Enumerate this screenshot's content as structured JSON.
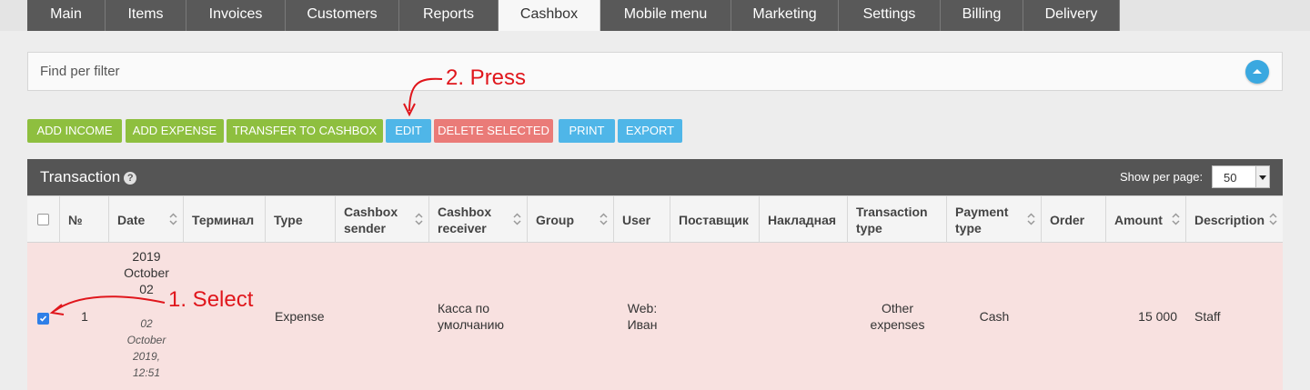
{
  "nav": {
    "tabs": [
      {
        "label": "Main"
      },
      {
        "label": "Items"
      },
      {
        "label": "Invoices"
      },
      {
        "label": "Customers"
      },
      {
        "label": "Reports"
      },
      {
        "label": "Cashbox",
        "active": true
      },
      {
        "label": "Mobile menu"
      },
      {
        "label": "Marketing"
      },
      {
        "label": "Settings"
      },
      {
        "label": "Billing"
      },
      {
        "label": "Delivery"
      }
    ]
  },
  "filter": {
    "label": "Find per filter",
    "toggle_icon": "chevron-up-icon"
  },
  "annotations": {
    "press": "2. Press",
    "select": "1. Select",
    "color": "#e0161c"
  },
  "toolbar": {
    "add_income": "ADD INCOME",
    "add_expense": "ADD EXPENSE",
    "transfer": "TRANSFER TO CASHBOX",
    "edit": "EDIT",
    "delete": "DELETE SELECTED",
    "print": "PRINT",
    "export": "EXPORT"
  },
  "panel": {
    "title": "Transaction",
    "per_page_label": "Show per page:",
    "per_page_value": "50"
  },
  "table": {
    "columns": {
      "num": "№",
      "date": "Date",
      "terminal": "Терминал",
      "type": "Type",
      "sender": "Cashbox sender",
      "receiver": "Cashbox receiver",
      "group": "Group",
      "user": "User",
      "supplier": "Поставщик",
      "waybill": "Накладная",
      "txtype": "Transaction type",
      "paytype": "Payment type",
      "order": "Order",
      "amount": "Amount",
      "description": "Description"
    },
    "rows": [
      {
        "selected": true,
        "num": "1",
        "date": "2019 October 02",
        "date_detail": "02 October 2019, 12:51",
        "terminal": "",
        "type": "Expense",
        "sender": "",
        "receiver": "Касса по умолчанию",
        "group": "",
        "user": "Web: Иван",
        "supplier": "",
        "waybill": "",
        "txtype": "Other expenses",
        "paytype": "Cash",
        "order": "",
        "amount": "15 000",
        "description": "Staff"
      }
    ]
  },
  "colors": {
    "green": "#8ebf3f",
    "blue": "#4fb6e8",
    "red": "#ea7b78",
    "selected_row": "#f8e1e0"
  }
}
